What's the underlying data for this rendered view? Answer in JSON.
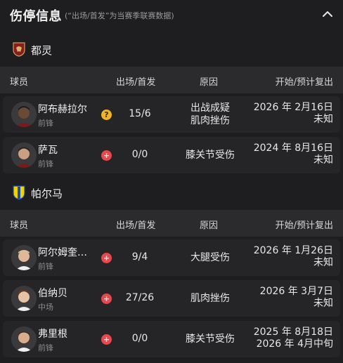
{
  "header": {
    "title": "伤停信息",
    "note": "(“出场/首发”为当赛季联赛数据)"
  },
  "columns": {
    "player": "球员",
    "apps": "出场/首发",
    "reason": "原因",
    "date": "开始/预计复出"
  },
  "teams": [
    {
      "name": "都灵",
      "logo_icon": "torino-crest-icon",
      "players": [
        {
          "name": "阿布赫拉尔",
          "position": "前锋",
          "status": "doubtful",
          "apps": "15/6",
          "reason": [
            "出战成疑",
            "肌肉挫伤"
          ],
          "date": [
            "2026 年 2月16日",
            "未知"
          ]
        },
        {
          "name": "萨瓦",
          "position": "前锋",
          "status": "injured",
          "apps": "0/0",
          "reason": [
            "膝关节受伤"
          ],
          "date": [
            "2024 年 8月16日",
            "未知"
          ]
        }
      ]
    },
    {
      "name": "帕尔马",
      "logo_icon": "parma-crest-icon",
      "players": [
        {
          "name": "阿尔姆奎斯特",
          "position": "前锋",
          "status": "injured",
          "apps": "9/4",
          "reason": [
            "大腿受伤"
          ],
          "date": [
            "2026 年 1月26日",
            "未知"
          ]
        },
        {
          "name": "伯纳贝",
          "position": "中场",
          "status": "injured",
          "apps": "27/26",
          "reason": [
            "肌肉挫伤"
          ],
          "date": [
            "2026 年 3月7日",
            "未知"
          ]
        },
        {
          "name": "弗里根",
          "position": "前锋",
          "status": "injured",
          "apps": "0/0",
          "reason": [
            "膝关节受伤"
          ],
          "date": [
            "2025 年 8月18日",
            "2026 年 4月中旬"
          ]
        }
      ]
    }
  ],
  "colors": {
    "doubtful": "#f0b429",
    "injured": "#e5484d"
  }
}
